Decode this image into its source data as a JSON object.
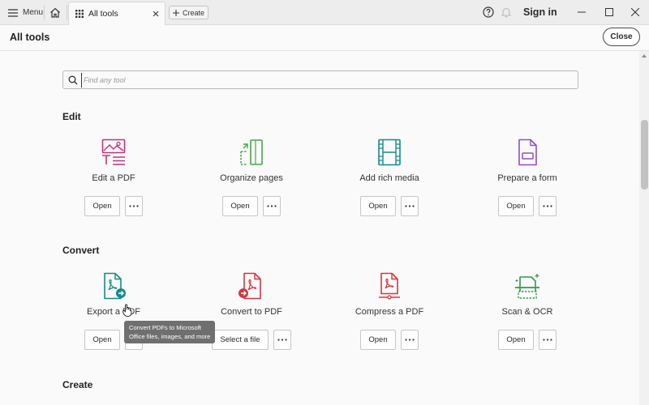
{
  "titlebar": {
    "menu_label": "Menu",
    "tab_label": "All tools",
    "create_label": "Create",
    "signin_label": "Sign in"
  },
  "header": {
    "title": "All tools",
    "close_label": "Close"
  },
  "search": {
    "placeholder": "Find any tool"
  },
  "sections": {
    "edit": {
      "title": "Edit",
      "tools": [
        {
          "name": "Edit a PDF",
          "button": "Open",
          "icon": "edit-pdf-icon",
          "color": "#c4327e"
        },
        {
          "name": "Organize pages",
          "button": "Open",
          "icon": "organize-pages-icon",
          "color": "#46a64a"
        },
        {
          "name": "Add rich media",
          "button": "Open",
          "icon": "rich-media-icon",
          "color": "#168a87"
        },
        {
          "name": "Prepare a form",
          "button": "Open",
          "icon": "prepare-form-icon",
          "color": "#8e4fc7"
        }
      ]
    },
    "convert": {
      "title": "Convert",
      "tools": [
        {
          "name": "Export a PDF",
          "button": "Open",
          "icon": "export-pdf-icon",
          "color": "#168a87"
        },
        {
          "name": "Convert to PDF",
          "button": "Select a file",
          "icon": "convert-to-pdf-icon",
          "color": "#d7373f"
        },
        {
          "name": "Compress a PDF",
          "button": "Open",
          "icon": "compress-pdf-icon",
          "color": "#d7373f"
        },
        {
          "name": "Scan & OCR",
          "button": "Open",
          "icon": "scan-ocr-icon",
          "color": "#2f9a4b"
        }
      ]
    },
    "create": {
      "title": "Create"
    }
  },
  "tooltip": {
    "line1": "Convert PDFs to Microsoft",
    "line2": "Office files, images, and more"
  }
}
